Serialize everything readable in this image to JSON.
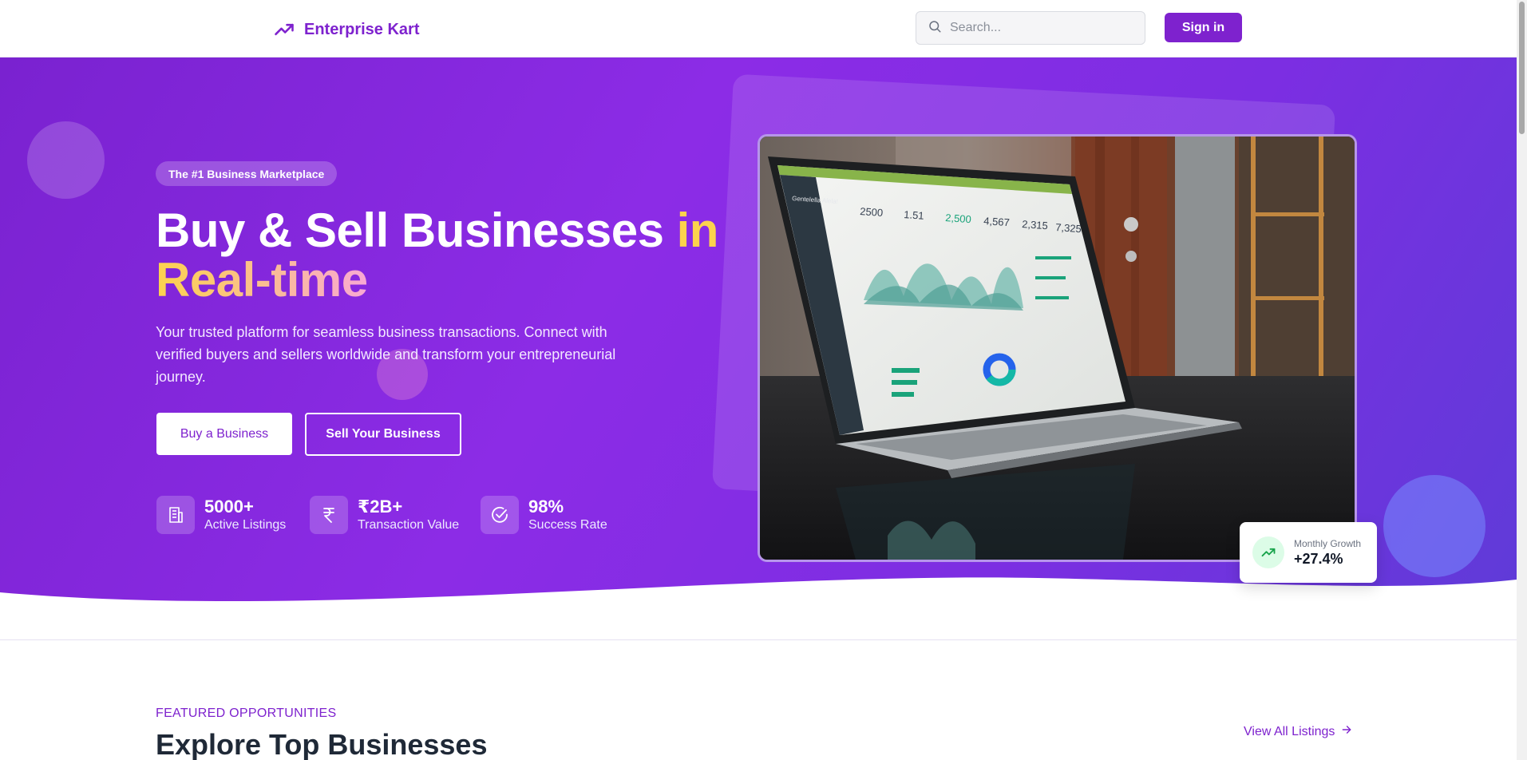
{
  "header": {
    "brand": "Enterprise Kart",
    "search_placeholder": "Search...",
    "signin_label": "Sign in"
  },
  "hero": {
    "badge": "The #1 Business Marketplace",
    "title_part1": "Buy & Sell Businesses ",
    "title_part2": "in",
    "title_part3": "Real-time",
    "subtitle": "Your trusted platform for seamless business transactions. Connect with verified buyers and sellers worldwide and transform your entrepreneurial journey.",
    "buy_button": "Buy a Business",
    "sell_button": "Sell Your Business",
    "stats": [
      {
        "value": "5000+",
        "label": "Active Listings",
        "icon": "building-icon"
      },
      {
        "value": "₹2B+",
        "label": "Transaction Value",
        "icon": "rupee-icon"
      },
      {
        "value": "98%",
        "label": "Success Rate",
        "icon": "check-circle-icon"
      }
    ],
    "growth_card": {
      "label": "Monthly Growth",
      "value": "+27.4%"
    }
  },
  "featured": {
    "label": "FEATURED OPPORTUNITIES",
    "title": "Explore Top Businesses",
    "view_all": "View All Listings"
  },
  "laptop_screen": {
    "dashboard_name": "Gentelella Alela!",
    "kpis": [
      "2500",
      "1.51",
      "2,500",
      "4,567",
      "2,315",
      "7,325"
    ]
  },
  "colors": {
    "brand": "#7e22ce",
    "accent_yellow": "#fcd34d",
    "accent_pink": "#f9a8d4",
    "growth_green": "#16a34a"
  }
}
